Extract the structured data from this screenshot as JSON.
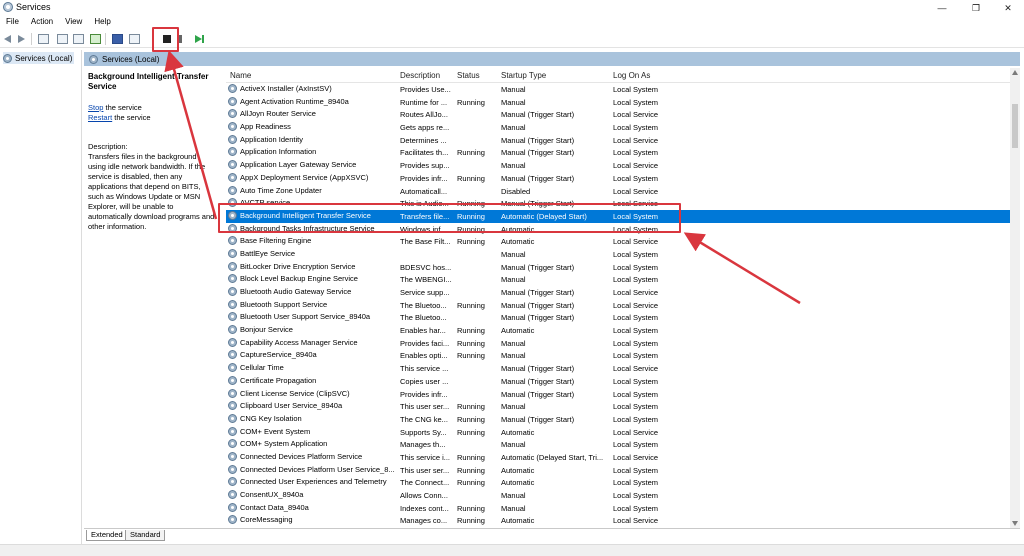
{
  "window": {
    "title": "Services",
    "controls": [
      "—",
      "❐",
      "✕"
    ]
  },
  "menu": [
    "File",
    "Action",
    "View",
    "Help"
  ],
  "tree": {
    "root_label": "Services (Local)"
  },
  "main": {
    "header": "Services (Local)"
  },
  "details": {
    "title": "Background Intelligent Transfer Service",
    "stop_link": "Stop",
    "stop_rest": " the service",
    "restart_link": "Restart",
    "restart_rest": " the service",
    "desc_label": "Description:",
    "desc_text": "Transfers files in the background using idle network bandwidth. If the service is disabled, then any applications that depend on BITS, such as Windows Update or MSN Explorer, will be unable to automatically download programs and other information."
  },
  "columns": {
    "name": "Name",
    "description": "Description",
    "status": "Status",
    "startup": "Startup Type",
    "logon": "Log On As"
  },
  "services": [
    {
      "name": "ActiveX Installer (AxInstSV)",
      "description": "Provides Use...",
      "status": "",
      "startup": "Manual",
      "logon": "Local System"
    },
    {
      "name": "Agent Activation Runtime_8940a",
      "description": "Runtime for ...",
      "status": "Running",
      "startup": "Manual",
      "logon": "Local System"
    },
    {
      "name": "AllJoyn Router Service",
      "description": "Routes AllJo...",
      "status": "",
      "startup": "Manual (Trigger Start)",
      "logon": "Local Service"
    },
    {
      "name": "App Readiness",
      "description": "Gets apps re...",
      "status": "",
      "startup": "Manual",
      "logon": "Local System"
    },
    {
      "name": "Application Identity",
      "description": "Determines ...",
      "status": "",
      "startup": "Manual (Trigger Start)",
      "logon": "Local Service"
    },
    {
      "name": "Application Information",
      "description": "Facilitates th...",
      "status": "Running",
      "startup": "Manual (Trigger Start)",
      "logon": "Local System"
    },
    {
      "name": "Application Layer Gateway Service",
      "description": "Provides sup...",
      "status": "",
      "startup": "Manual",
      "logon": "Local Service"
    },
    {
      "name": "AppX Deployment Service (AppXSVC)",
      "description": "Provides infr...",
      "status": "Running",
      "startup": "Manual (Trigger Start)",
      "logon": "Local System"
    },
    {
      "name": "Auto Time Zone Updater",
      "description": "Automaticall...",
      "status": "",
      "startup": "Disabled",
      "logon": "Local Service"
    },
    {
      "name": "AVCTP service",
      "description": "This is Audio...",
      "status": "Running",
      "startup": "Manual (Trigger Start)",
      "logon": "Local Service"
    },
    {
      "name": "Background Intelligent Transfer Service",
      "description": "Transfers file...",
      "status": "Running",
      "startup": "Automatic (Delayed Start)",
      "logon": "Local System",
      "selected": true
    },
    {
      "name": "Background Tasks Infrastructure Service",
      "description": "Windows inf...",
      "status": "Running",
      "startup": "Automatic",
      "logon": "Local System"
    },
    {
      "name": "Base Filtering Engine",
      "description": "The Base Filt...",
      "status": "Running",
      "startup": "Automatic",
      "logon": "Local Service"
    },
    {
      "name": "BattlEye Service",
      "description": "",
      "status": "",
      "startup": "Manual",
      "logon": "Local System"
    },
    {
      "name": "BitLocker Drive Encryption Service",
      "description": "BDESVC hos...",
      "status": "",
      "startup": "Manual (Trigger Start)",
      "logon": "Local System"
    },
    {
      "name": "Block Level Backup Engine Service",
      "description": "The WBENGI...",
      "status": "",
      "startup": "Manual",
      "logon": "Local System"
    },
    {
      "name": "Bluetooth Audio Gateway Service",
      "description": "Service supp...",
      "status": "",
      "startup": "Manual (Trigger Start)",
      "logon": "Local Service"
    },
    {
      "name": "Bluetooth Support Service",
      "description": "The Bluetoo...",
      "status": "Running",
      "startup": "Manual (Trigger Start)",
      "logon": "Local Service"
    },
    {
      "name": "Bluetooth User Support Service_8940a",
      "description": "The Bluetoo...",
      "status": "",
      "startup": "Manual (Trigger Start)",
      "logon": "Local System"
    },
    {
      "name": "Bonjour Service",
      "description": "Enables har...",
      "status": "Running",
      "startup": "Automatic",
      "logon": "Local System"
    },
    {
      "name": "Capability Access Manager Service",
      "description": "Provides faci...",
      "status": "Running",
      "startup": "Manual",
      "logon": "Local System"
    },
    {
      "name": "CaptureService_8940a",
      "description": "Enables opti...",
      "status": "Running",
      "startup": "Manual",
      "logon": "Local System"
    },
    {
      "name": "Cellular Time",
      "description": "This service ...",
      "status": "",
      "startup": "Manual (Trigger Start)",
      "logon": "Local Service"
    },
    {
      "name": "Certificate Propagation",
      "description": "Copies user ...",
      "status": "",
      "startup": "Manual (Trigger Start)",
      "logon": "Local System"
    },
    {
      "name": "Client License Service (ClipSVC)",
      "description": "Provides infr...",
      "status": "",
      "startup": "Manual (Trigger Start)",
      "logon": "Local System"
    },
    {
      "name": "Clipboard User Service_8940a",
      "description": "This user ser...",
      "status": "Running",
      "startup": "Manual",
      "logon": "Local System"
    },
    {
      "name": "CNG Key Isolation",
      "description": "The CNG ke...",
      "status": "Running",
      "startup": "Manual (Trigger Start)",
      "logon": "Local System"
    },
    {
      "name": "COM+ Event System",
      "description": "Supports Sy...",
      "status": "Running",
      "startup": "Automatic",
      "logon": "Local Service"
    },
    {
      "name": "COM+ System Application",
      "description": "Manages th...",
      "status": "",
      "startup": "Manual",
      "logon": "Local System"
    },
    {
      "name": "Connected Devices Platform Service",
      "description": "This service i...",
      "status": "Running",
      "startup": "Automatic (Delayed Start, Tri...",
      "logon": "Local Service"
    },
    {
      "name": "Connected Devices Platform User Service_8...",
      "description": "This user ser...",
      "status": "Running",
      "startup": "Automatic",
      "logon": "Local System"
    },
    {
      "name": "Connected User Experiences and Telemetry",
      "description": "The Connect...",
      "status": "Running",
      "startup": "Automatic",
      "logon": "Local System"
    },
    {
      "name": "ConsentUX_8940a",
      "description": "Allows Conn...",
      "status": "",
      "startup": "Manual",
      "logon": "Local System"
    },
    {
      "name": "Contact Data_8940a",
      "description": "Indexes cont...",
      "status": "Running",
      "startup": "Manual",
      "logon": "Local System"
    },
    {
      "name": "CoreMessaging",
      "description": "Manages co...",
      "status": "Running",
      "startup": "Automatic",
      "logon": "Local Service"
    }
  ],
  "tabs": [
    "Extended",
    "Standard"
  ],
  "colors": {
    "selection": "#0078d7",
    "annotation": "#d9363e",
    "header_bar": "#a9c3dc"
  },
  "icons": {
    "toolbar": [
      "back-icon",
      "forward-icon",
      "show-hide-console-tree-icon",
      "export-list-icon",
      "refresh-icon",
      "help-icon",
      "properties-icon",
      "stop-service-icon",
      "pause-service-icon",
      "start-service-icon"
    ],
    "service_row": "gear-icon"
  }
}
